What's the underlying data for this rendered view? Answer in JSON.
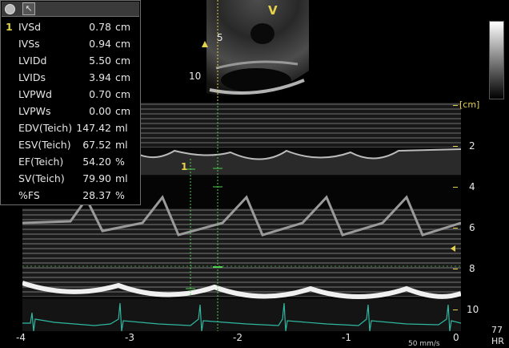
{
  "measurements": {
    "index": "1",
    "rows": [
      {
        "label": "IVSd",
        "value": "0.78",
        "unit": "cm"
      },
      {
        "label": "IVSs",
        "value": "0.94",
        "unit": "cm"
      },
      {
        "label": "LVIDd",
        "value": "5.50",
        "unit": "cm"
      },
      {
        "label": "LVIDs",
        "value": "3.94",
        "unit": "cm"
      },
      {
        "label": "LVPWd",
        "value": "0.70",
        "unit": "cm"
      },
      {
        "label": "LVPWs",
        "value": "0.00",
        "unit": "cm"
      },
      {
        "label": "EDV(Teich)",
        "value": "147.42",
        "unit": "ml"
      },
      {
        "label": "ESV(Teich)",
        "value": "67.52",
        "unit": "ml"
      },
      {
        "label": "EF(Teich)",
        "value": "54.20",
        "unit": "%"
      },
      {
        "label": "SV(Teich)",
        "value": "79.90",
        "unit": "ml"
      },
      {
        "label": "%FS",
        "value": "28.37",
        "unit": "%"
      }
    ]
  },
  "sector": {
    "orientation_marker": "V",
    "depth_labels": [
      "5",
      "10"
    ]
  },
  "depth_scale": {
    "unit": "[cm]",
    "ticks": [
      "2",
      "4",
      "6",
      "8",
      "10"
    ]
  },
  "time_axis": {
    "labels": [
      "-4",
      "-3",
      "-2",
      "-1",
      "0"
    ],
    "sweep_speed": "50 mm/s"
  },
  "heart_rate": {
    "value": "77",
    "label": "HR"
  },
  "caliper": {
    "label": "1"
  },
  "colors": {
    "accent_yellow": "#e6d24a",
    "ecg_trace": "#2fb7a0",
    "caliper_green": "#4fd04f"
  },
  "icons": {
    "record": "record-dot-icon",
    "tool": "cursor-tool-icon"
  }
}
